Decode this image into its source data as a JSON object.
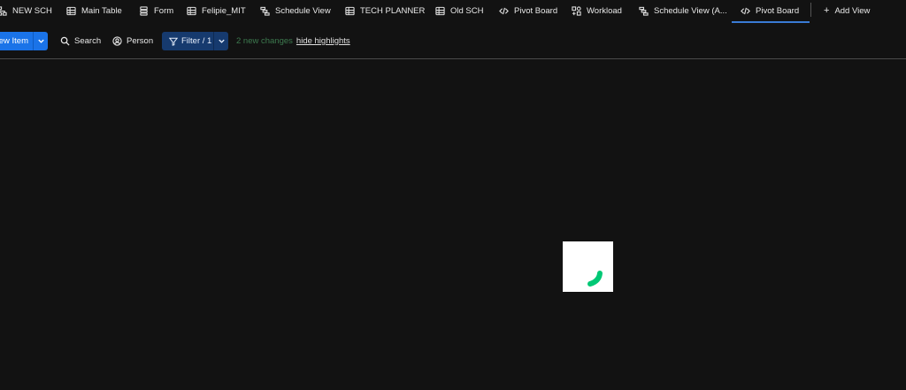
{
  "views": {
    "tabs": [
      {
        "label": "NEW SCH",
        "icon": "hierarchy-icon",
        "name": "tab-new-sch"
      },
      {
        "label": "Main Table",
        "icon": "table-icon",
        "name": "tab-main-table"
      },
      {
        "label": "Form",
        "icon": "form-icon",
        "name": "tab-form"
      },
      {
        "label": "Felipie_MIT",
        "icon": "table-icon",
        "name": "tab-felipie-mit"
      },
      {
        "label": "Schedule View",
        "icon": "gantt-icon",
        "name": "tab-schedule-view"
      },
      {
        "label": "TECH PLANNER",
        "icon": "table-icon",
        "name": "tab-tech-planner"
      },
      {
        "label": "Old SCH",
        "icon": "table-icon",
        "name": "tab-old-sch"
      },
      {
        "label": "Pivot Board",
        "icon": "code-icon",
        "name": "tab-pivot-board-1"
      },
      {
        "label": "Workload",
        "icon": "workload-icon",
        "name": "tab-workload"
      },
      {
        "label": "Schedule View (A...",
        "icon": "gantt-icon",
        "name": "tab-schedule-view-a"
      },
      {
        "label": "Pivot Board",
        "icon": "code-icon",
        "name": "tab-pivot-board-2"
      }
    ],
    "active_tab": "Pivot Board",
    "add_view_label": "Add View"
  },
  "toolbar": {
    "new_item_label": "New Item",
    "search_label": "Search",
    "person_label": "Person",
    "filter_label": "Filter / 1",
    "changes_text": "2 new changes",
    "hide_highlights_label": "hide highlights"
  },
  "colors": {
    "background": "#121212",
    "accent": "#1a73e8",
    "filter_bg": "#163a6e",
    "changes_green": "#3d7a4f",
    "loader_green": "#00c875"
  }
}
